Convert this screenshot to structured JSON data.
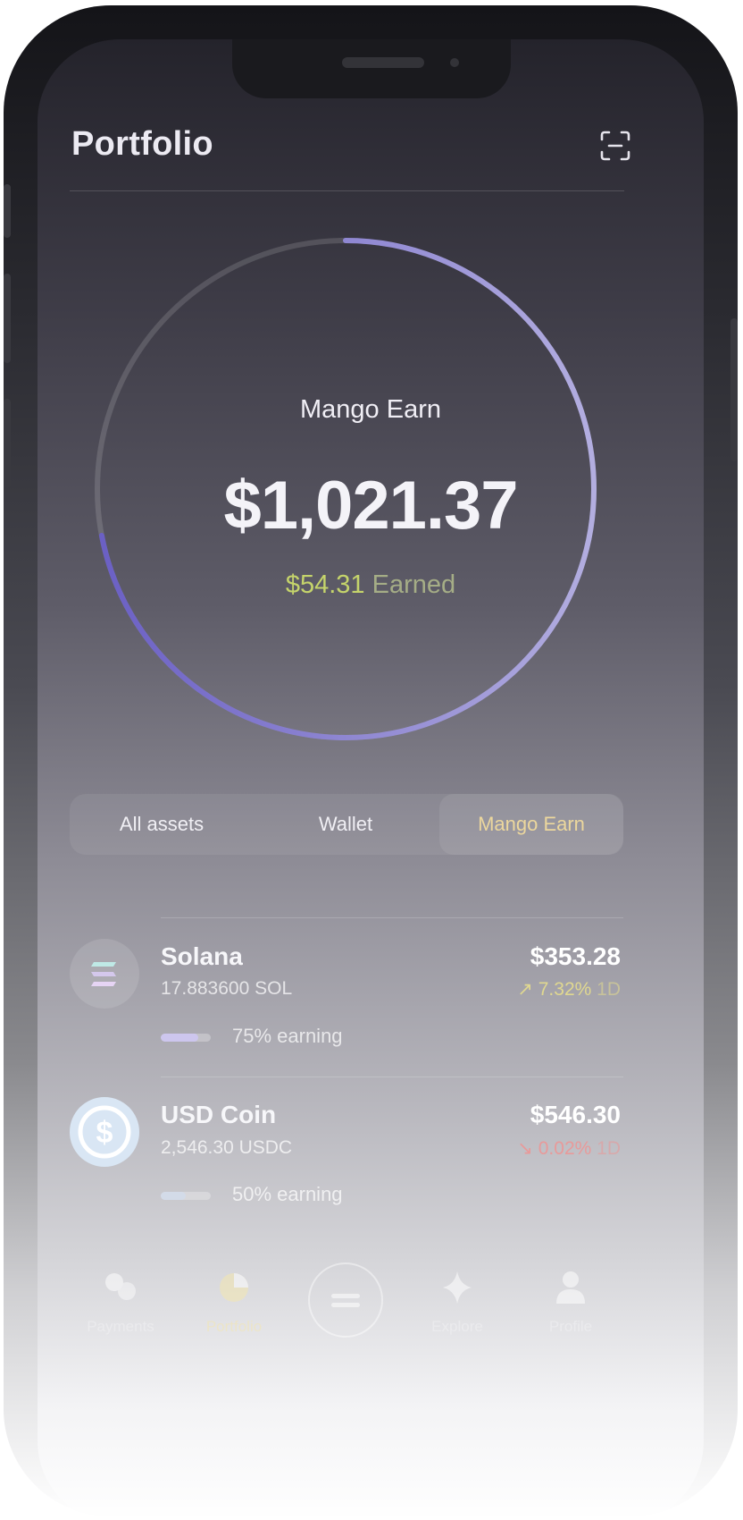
{
  "header": {
    "title": "Portfolio",
    "scan_icon": "scan-icon"
  },
  "summary": {
    "label": "Mango Earn",
    "balance": "$1,021.37",
    "earned_amount": "$54.31",
    "earned_label": "Earned",
    "ring_progress": 0.72,
    "ring_color": "#9a8fdc"
  },
  "tabs": [
    {
      "label": "All assets",
      "active": false
    },
    {
      "label": "Wallet",
      "active": false
    },
    {
      "label": "Mango Earn",
      "active": true
    }
  ],
  "assets": [
    {
      "name": "Solana",
      "amount": "17.883600 SOL",
      "value": "$353.28",
      "change": "7.32%",
      "change_period": "1D",
      "direction": "up",
      "earning_label": "75% earning",
      "earning_fraction": 0.75,
      "icon": "solana-icon"
    },
    {
      "name": "USD Coin",
      "amount": "2,546.30 USDC",
      "value": "$546.30",
      "change": "0.02%",
      "change_period": "1D",
      "direction": "down",
      "earning_label": "50% earning",
      "earning_fraction": 0.5,
      "icon": "usdc-icon"
    }
  ],
  "nav": [
    {
      "label": "Payments",
      "icon": "payments-icon"
    },
    {
      "label": "Portfolio",
      "icon": "portfolio-icon"
    },
    {
      "label": "",
      "icon": "menu-icon"
    },
    {
      "label": "Explore",
      "icon": "explore-icon"
    },
    {
      "label": "Profile",
      "icon": "profile-icon"
    }
  ],
  "colors": {
    "accent_purple": "#9a8fdc",
    "earned_green": "#c5d46b",
    "active_tab": "#ecd79d",
    "positive": "#e0d890",
    "negative": "#e89a9a"
  }
}
